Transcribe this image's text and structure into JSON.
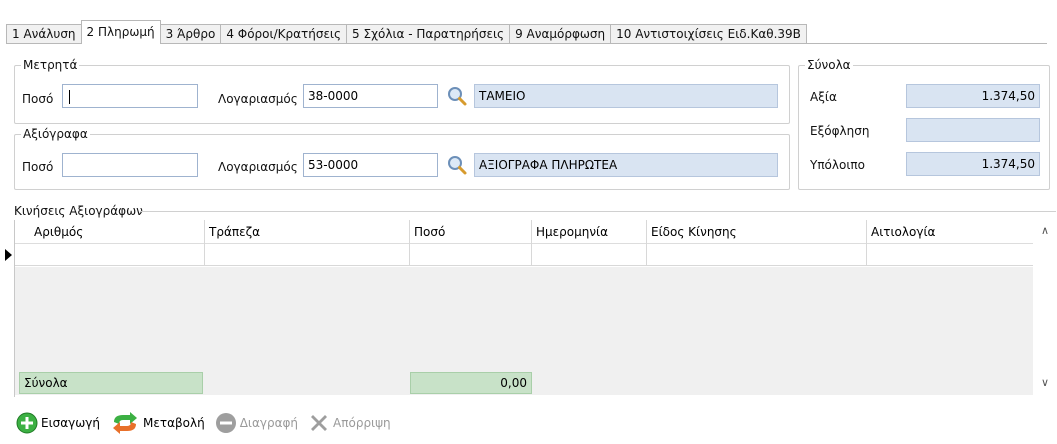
{
  "tabs": [
    {
      "label": "1 Ανάλυση"
    },
    {
      "label": "2 Πληρωμή"
    },
    {
      "label": "3 Άρθρο"
    },
    {
      "label": "4 Φόροι/Κρατήσεις"
    },
    {
      "label": "5 Σχόλια - Παρατηρήσεις"
    },
    {
      "label": "9 Αναμόρφωση"
    },
    {
      "label": "10 Αντιστοιχίσεις Ειδ.Καθ.39Β"
    }
  ],
  "cash": {
    "legend": "Μετρητά",
    "amount_label": "Ποσό",
    "amount_value": "",
    "account_label": "Λογαριασμός",
    "account_value": "38-0000",
    "account_name": "ΤΑΜΕΙΟ"
  },
  "checks": {
    "legend": "Αξιόγραφα",
    "amount_label": "Ποσό",
    "amount_value": "",
    "account_label": "Λογαριασμός",
    "account_value": "53-0000",
    "account_name": "ΑΞΙΟΓΡΑΦΑ ΠΛΗΡΩΤΕΑ"
  },
  "totals": {
    "legend": "Σύνολα",
    "value_label": "Αξία",
    "value": "1.374,50",
    "settlement_label": "Εξόφληση",
    "settlement": "",
    "balance_label": "Υπόλοιπο",
    "balance": "1.374,50"
  },
  "movements": {
    "legend": "Κινήσεις Αξιογράφων",
    "columns": [
      "Αριθμός",
      "Τράπεζα",
      "Ποσό",
      "Ημερομηνία",
      "Είδος Κίνησης",
      "Αιτιολογία"
    ],
    "footer_label": "Σύνολα",
    "footer_amount": "0,00"
  },
  "toolbar": {
    "insert": "Εισαγωγή",
    "modify": "Μεταβολή",
    "delete": "Διαγραφή",
    "reject": "Απόρριψη"
  }
}
